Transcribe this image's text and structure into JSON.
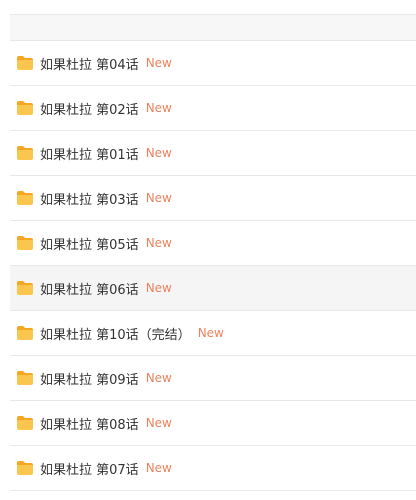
{
  "colors": {
    "new_badge": "#e8835f",
    "folder": "#fbc64d",
    "folder_tab": "#f5a623"
  },
  "files": [
    {
      "name": "如果杜拉 第04话",
      "badge": "New"
    },
    {
      "name": "如果杜拉 第02话",
      "badge": "New"
    },
    {
      "name": "如果杜拉 第01话",
      "badge": "New"
    },
    {
      "name": "如果杜拉 第03话",
      "badge": "New"
    },
    {
      "name": "如果杜拉 第05话",
      "badge": "New"
    },
    {
      "name": "如果杜拉 第06话",
      "badge": "New"
    },
    {
      "name": "如果杜拉 第10话（完结）",
      "badge": "New"
    },
    {
      "name": "如果杜拉 第09话",
      "badge": "New"
    },
    {
      "name": "如果杜拉 第08话",
      "badge": "New"
    },
    {
      "name": "如果杜拉 第07话",
      "badge": "New"
    }
  ]
}
